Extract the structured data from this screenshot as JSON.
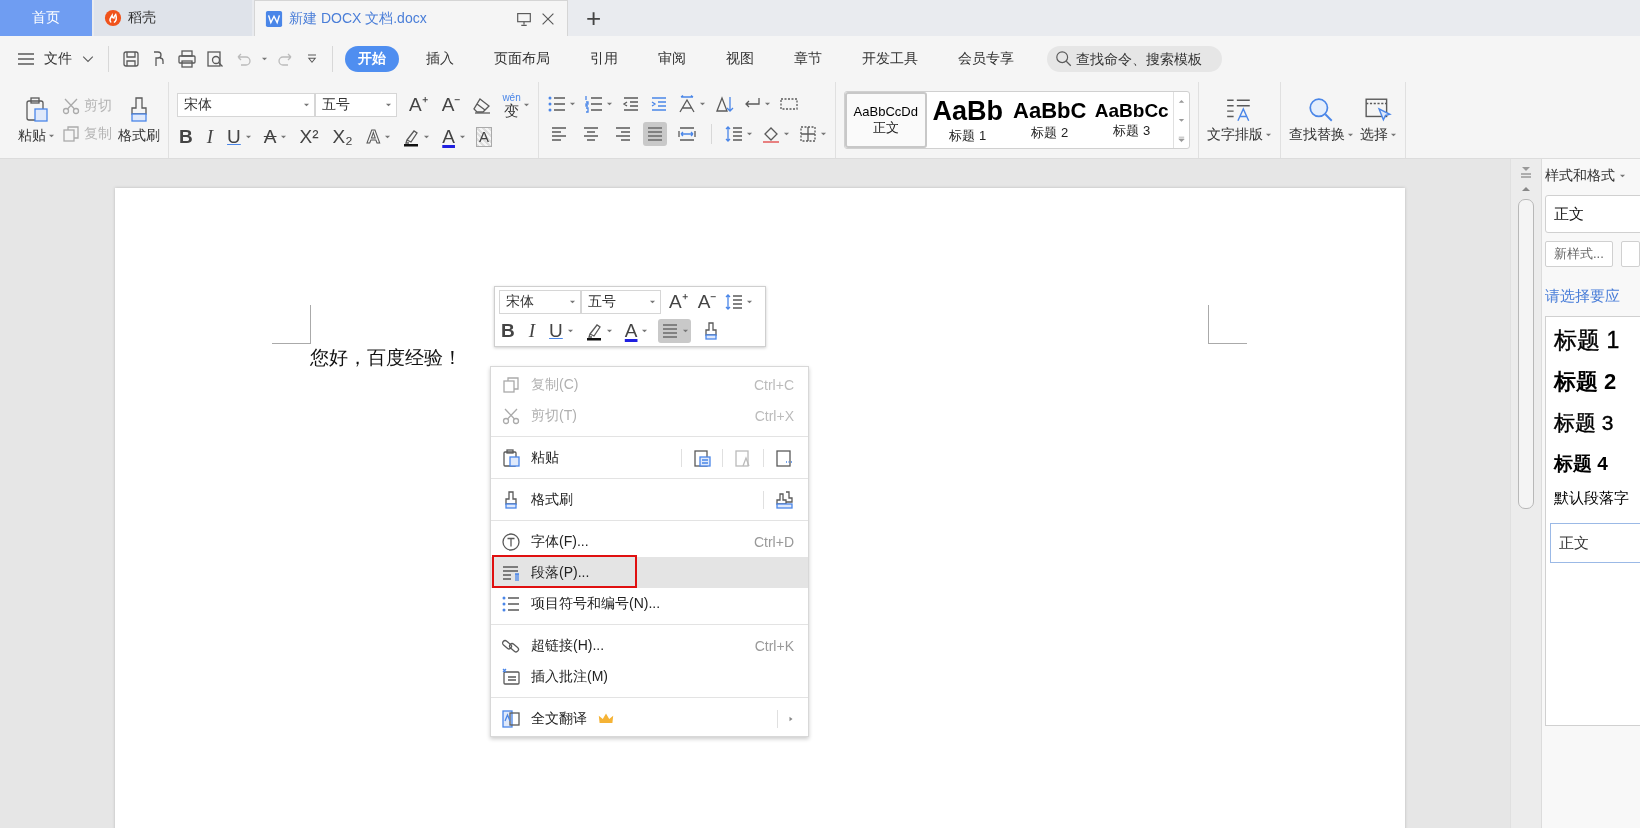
{
  "tabs": [
    {
      "label": "首页",
      "kind": "home",
      "selected": false
    },
    {
      "label": "稻壳",
      "kind": "app",
      "selected": false
    },
    {
      "label": "新建 DOCX 文档.docx",
      "kind": "doc",
      "selected": true
    }
  ],
  "new_tab": "+",
  "file_menu": "文件",
  "ribbon_tabs": [
    {
      "label": "开始",
      "selected": true
    },
    {
      "label": "插入",
      "selected": false
    },
    {
      "label": "页面布局",
      "selected": false
    },
    {
      "label": "引用",
      "selected": false
    },
    {
      "label": "审阅",
      "selected": false
    },
    {
      "label": "视图",
      "selected": false
    },
    {
      "label": "章节",
      "selected": false
    },
    {
      "label": "开发工具",
      "selected": false
    },
    {
      "label": "会员专享",
      "selected": false
    }
  ],
  "search": {
    "placeholder": "查找命令、搜索模板"
  },
  "clipboard": {
    "paste": "粘贴",
    "cut": {
      "label": "剪切",
      "disabled": true
    },
    "copy": {
      "label": "复制",
      "disabled": true
    },
    "painter": "格式刷"
  },
  "font": {
    "name": "宋体",
    "size": "五号",
    "grow": "A⁺",
    "shrink": "A⁻",
    "phonetic": "wén",
    "phonetic_base": "变"
  },
  "font_buttons": [
    {
      "glyph": "B",
      "kind": "bold"
    },
    {
      "glyph": "I",
      "kind": "italic"
    },
    {
      "glyph": "U",
      "kind": "underline"
    },
    {
      "glyph": "A",
      "kind": "strike"
    },
    {
      "glyph": "X²",
      "kind": "plain"
    },
    {
      "glyph": "X₂",
      "kind": "plain"
    },
    {
      "glyph": "A",
      "kind": "outline"
    },
    {
      "kind": "highlight"
    },
    {
      "glyph": "A",
      "kind": "color"
    },
    {
      "glyph": "A",
      "kind": "shade"
    }
  ],
  "align_buttons": [
    {
      "selected": false
    },
    {
      "selected": false
    },
    {
      "selected": false
    },
    {
      "selected": true
    },
    {
      "selected": false
    }
  ],
  "styles": [
    {
      "preview": "AaBbCcDd",
      "label": "正文",
      "kind": "normal",
      "selected": true
    },
    {
      "preview": "AaBb",
      "label": "标题 1",
      "kind": "h1",
      "selected": false
    },
    {
      "preview": "AaBbC",
      "label": "标题 2",
      "kind": "h2",
      "selected": false
    },
    {
      "preview": "AaBbCc",
      "label": "标题 3",
      "kind": "h3",
      "selected": false
    }
  ],
  "text_layout": "文字排版",
  "find_replace": "查找替换",
  "select": "选择",
  "document": {
    "text": "您好，百度经验！"
  },
  "mini_toolbar": {
    "font": "宋体",
    "size": "五号",
    "grow": "A⁺",
    "shrink": "A⁻",
    "buttons": [
      {
        "glyph": "B",
        "kind": "bold"
      },
      {
        "glyph": "I",
        "kind": "italic"
      },
      {
        "glyph": "U",
        "kind": "underline"
      },
      {
        "kind": "highlight"
      },
      {
        "glyph": "A",
        "kind": "color"
      }
    ],
    "align_selected": true
  },
  "context_menu": [
    {
      "kind": "item",
      "label": "复制(C)",
      "shortcut": "Ctrl+C",
      "disabled": true,
      "selected": false,
      "outlined": false
    },
    {
      "kind": "item",
      "label": "剪切(T)",
      "shortcut": "Ctrl+X",
      "disabled": true,
      "selected": false,
      "outlined": false
    },
    {
      "kind": "separator"
    },
    {
      "kind": "paste",
      "label": "粘贴",
      "disabled": false,
      "selected": false,
      "outlined": false
    },
    {
      "kind": "separator"
    },
    {
      "kind": "painter",
      "label": "格式刷",
      "disabled": false,
      "selected": false,
      "outlined": false
    },
    {
      "kind": "separator"
    },
    {
      "kind": "item",
      "label": "字体(F)...",
      "shortcut": "Ctrl+D",
      "disabled": false,
      "selected": false,
      "outlined": false
    },
    {
      "kind": "item",
      "label": "段落(P)...",
      "disabled": false,
      "selected": true,
      "outlined": true
    },
    {
      "kind": "item",
      "label": "项目符号和编号(N)...",
      "disabled": false,
      "selected": false,
      "outlined": false
    },
    {
      "kind": "separator"
    },
    {
      "kind": "item",
      "label": "超链接(H)...",
      "shortcut": "Ctrl+K",
      "disabled": false,
      "selected": false,
      "outlined": false
    },
    {
      "kind": "item",
      "label": "插入批注(M)",
      "disabled": false,
      "selected": false,
      "outlined": false
    },
    {
      "kind": "separator"
    },
    {
      "kind": "submenu",
      "label": "全文翻译",
      "disabled": false,
      "selected": false,
      "outlined": false
    }
  ],
  "styles_panel": {
    "title": "样式和格式",
    "current": "正文",
    "new_style": "新样式...",
    "prompt": "请选择要应",
    "styles": [
      {
        "label": "标题 1",
        "kind": "h1"
      },
      {
        "label": "标题 2",
        "kind": "h2"
      },
      {
        "label": "标题 3",
        "kind": "h3"
      },
      {
        "label": "标题 4",
        "kind": "h4"
      },
      {
        "label": "默认段落字",
        "kind": "plain"
      }
    ],
    "selected_style": "正文"
  }
}
